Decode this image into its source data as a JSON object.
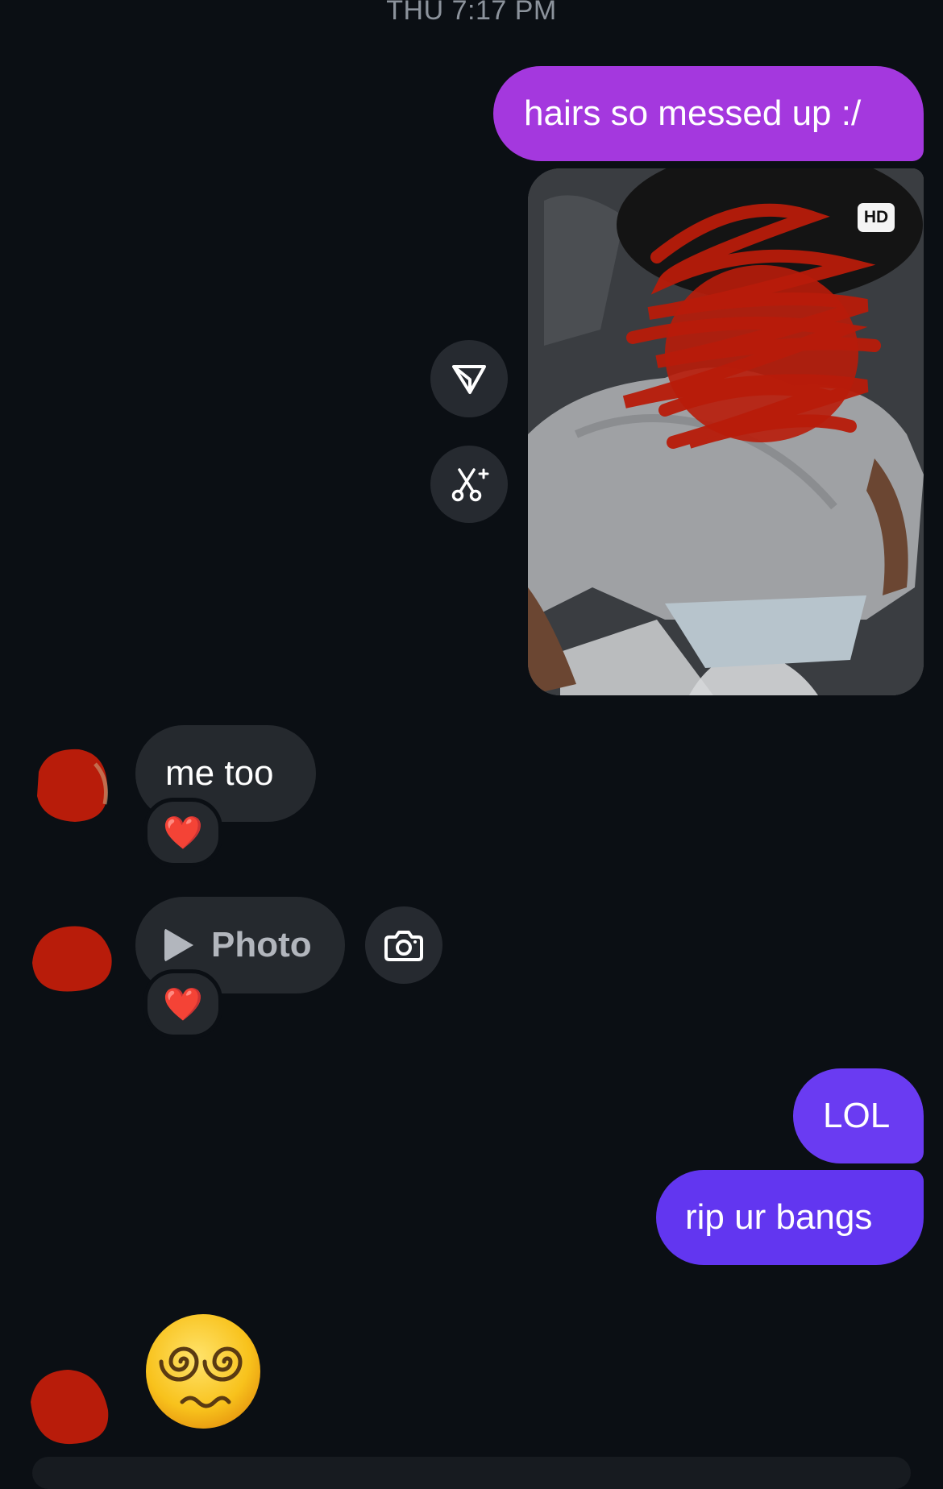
{
  "conversation": {
    "timestamp": "THU 7:17 PM"
  },
  "messages": {
    "outgoing_1": "hairs so messed up :/",
    "photo_badge": "HD",
    "incoming_1": "me too",
    "incoming_photo_label": "Photo",
    "reaction_emoji": "❤️",
    "outgoing_2": "LOL",
    "outgoing_3": "rip ur bangs",
    "incoming_emoji_name": "face-with-spiral-eyes"
  },
  "colors": {
    "background": "#0b0f14",
    "outgoing_purple": "#a438de",
    "outgoing_violet": "#6a3bf2",
    "incoming_bubble": "#25292e",
    "scribble_red": "#b81c0a"
  },
  "icons": {
    "share": "send-icon",
    "ai_edit": "sparkle-scissors-icon",
    "camera": "camera-icon",
    "play": "play-icon"
  }
}
